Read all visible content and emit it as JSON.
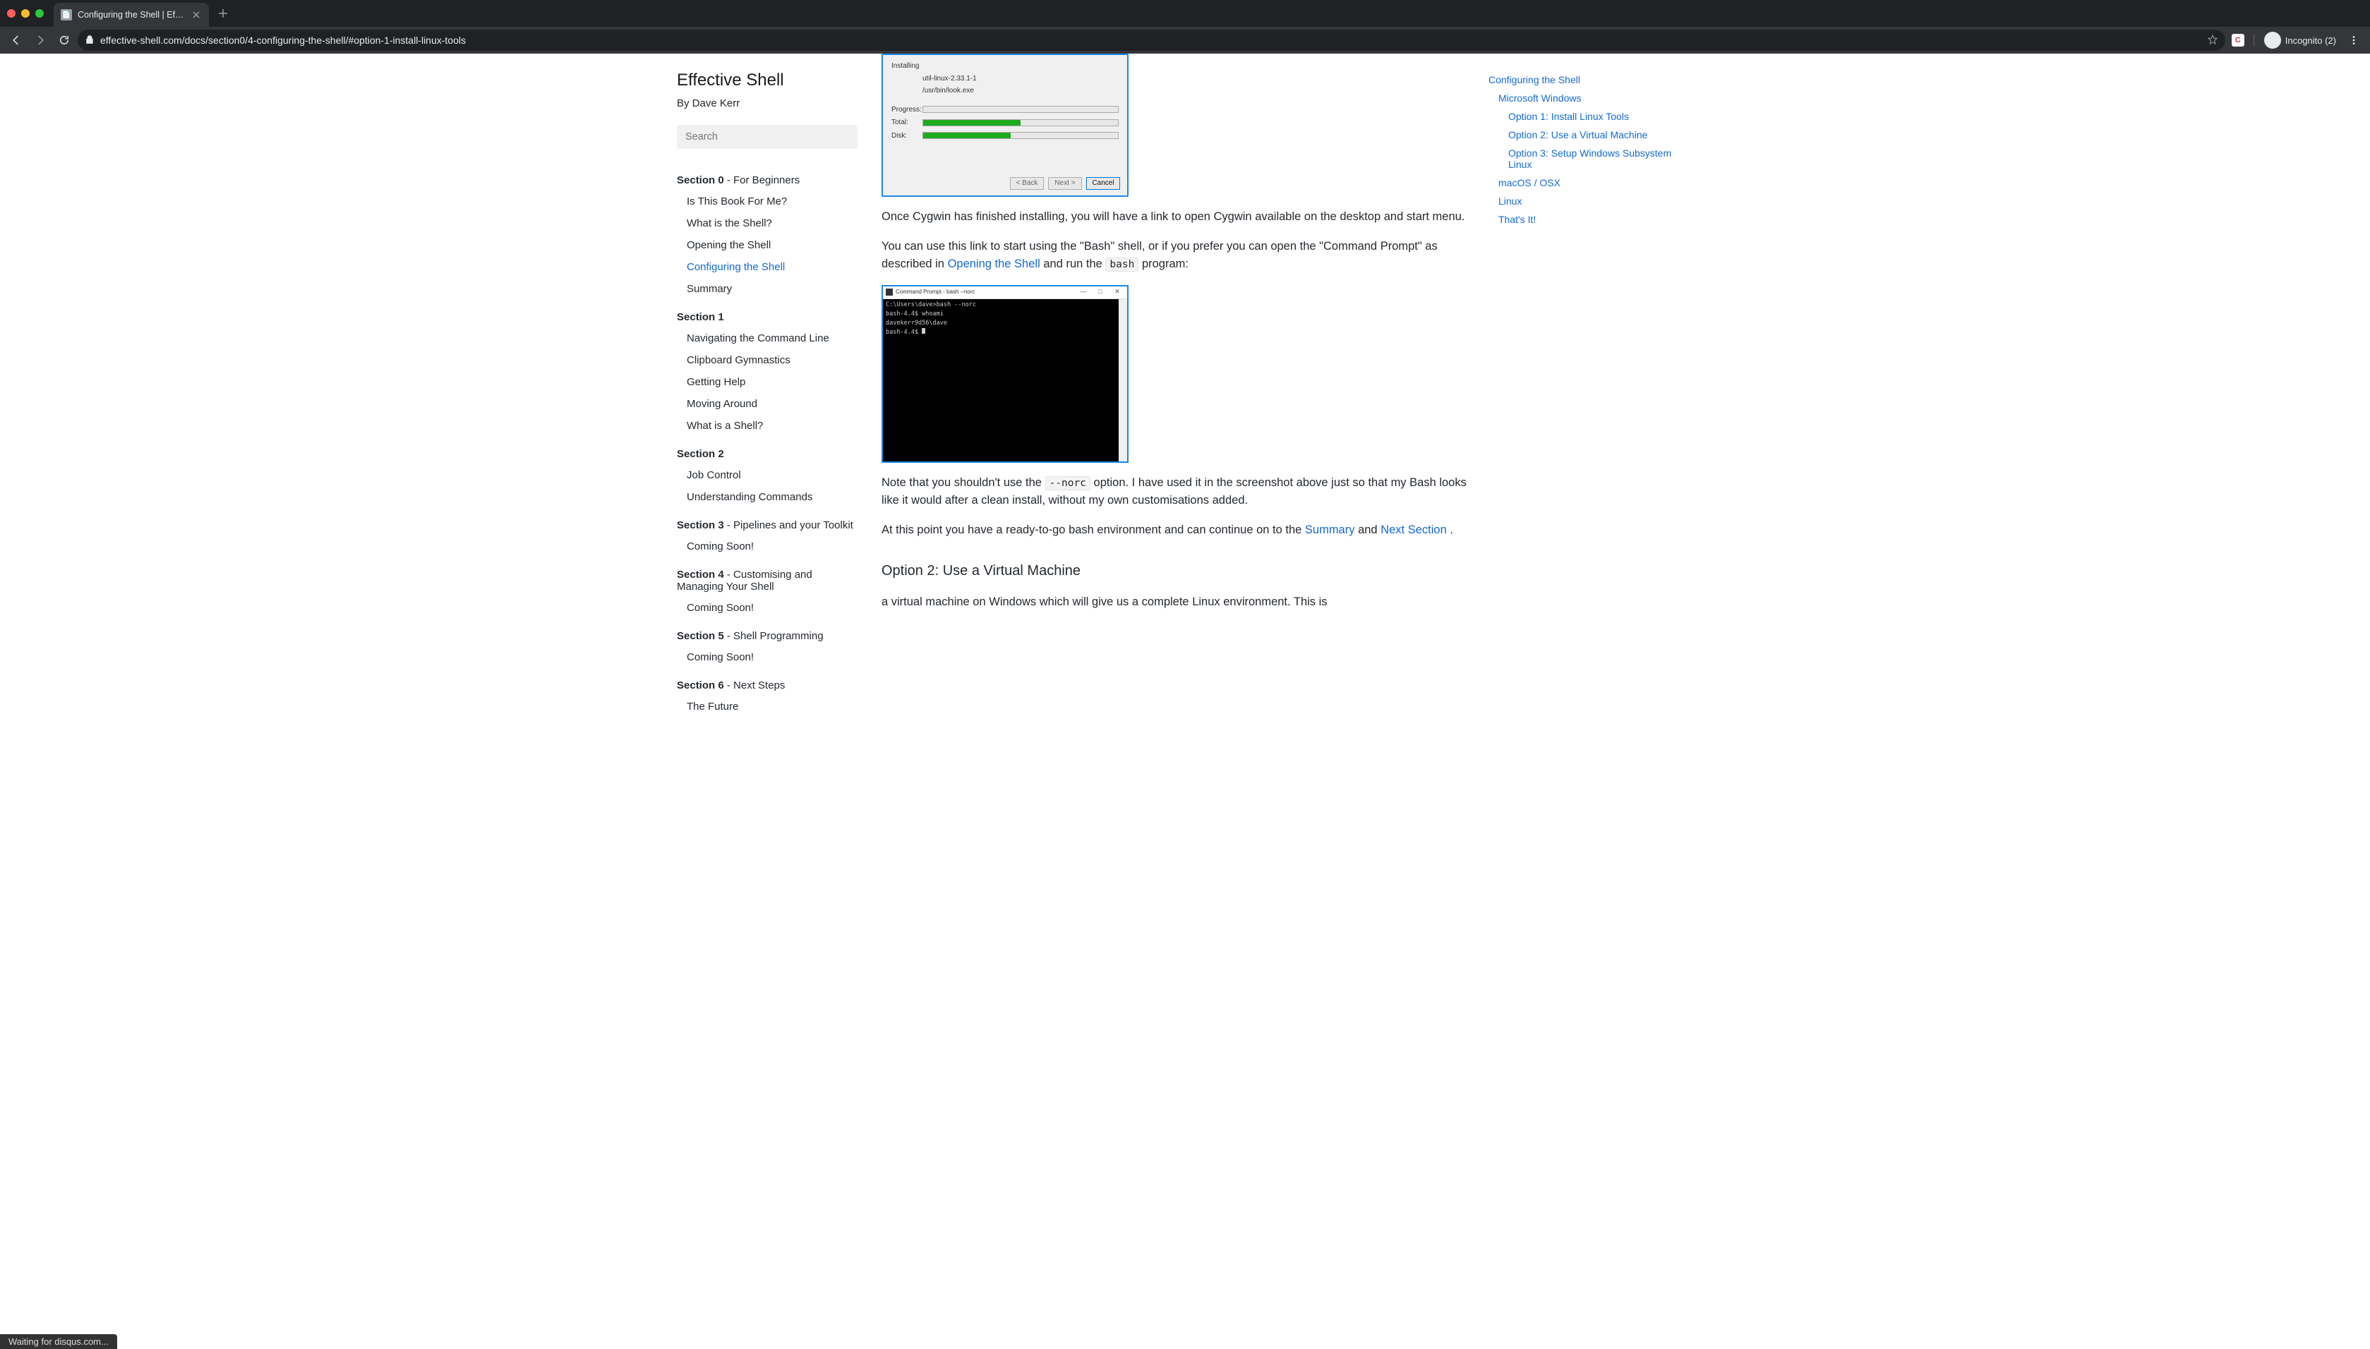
{
  "browser": {
    "tab_title": "Configuring the Shell | Effectiv",
    "url": "effective-shell.com/docs/section0/4-configuring-the-shell/#option-1-install-linux-tools",
    "incognito_label": "Incognito (2)",
    "status_text": "Waiting for disqus.com..."
  },
  "site": {
    "title": "Effective Shell",
    "byline": "By Dave Kerr",
    "search_placeholder": "Search"
  },
  "nav": {
    "s0_title_b": "Section 0",
    "s0_title_r": " - For Beginners",
    "s0_items": [
      "Is This Book For Me?",
      "What is the Shell?",
      "Opening the Shell",
      "Configuring the Shell",
      "Summary"
    ],
    "s1_title_b": "Section 1",
    "s1_title_r": "",
    "s1_items": [
      "Navigating the Command Line",
      "Clipboard Gymnastics",
      "Getting Help",
      "Moving Around",
      "What is a Shell?"
    ],
    "s2_title_b": "Section 2",
    "s2_title_r": "",
    "s2_items": [
      "Job Control",
      "Understanding Commands"
    ],
    "s3_title_b": "Section 3",
    "s3_title_r": " - Pipelines and your Toolkit",
    "s3_items": [
      "Coming Soon!"
    ],
    "s4_title_b": "Section 4",
    "s4_title_r": " - Customising and Managing Your Shell",
    "s4_items": [
      "Coming Soon!"
    ],
    "s5_title_b": "Section 5",
    "s5_title_r": " - Shell Programming",
    "s5_items": [
      "Coming Soon!"
    ],
    "s6_title_b": "Section 6",
    "s6_title_r": " - Next Steps",
    "s6_items": [
      "The Future"
    ]
  },
  "cygwin": {
    "installing": "Installing",
    "pkg": "util-linux-2.33.1-1",
    "path": "/usr/bin/look.exe",
    "lbl_progress": "Progress:",
    "lbl_total": "Total:",
    "lbl_disk": "Disk:",
    "btn_back": "< Back",
    "btn_next": "Next >",
    "btn_cancel": "Cancel"
  },
  "term": {
    "title": "Command Prompt - bash  --norc",
    "line1": "C:\\Users\\dave>bash --norc",
    "line2": "bash-4.4$ whoami",
    "line3": "davekerr9d56\\dave",
    "line4": "bash-4.4$ "
  },
  "content": {
    "p1": "Once Cygwin has finished installing, you will have a link to open Cygwin available on the desktop and start menu.",
    "p2a": "You can use this link to start using the \"Bash\" shell, or if you prefer you can open the \"Command Prompt\" as described in ",
    "p2_link": "Opening the Shell",
    "p2b": " and run the ",
    "p2_code": "bash",
    "p2c": " program:",
    "p3a": "Note that you shouldn't use the ",
    "p3_code": "--norc",
    "p3b": " option. I have used it in the screenshot above just so that my Bash looks like it would after a clean install, without my own customisations added.",
    "p4a": "At this point you have a ready-to-go bash environment and can continue on to the ",
    "p4_link1": "Summary",
    "p4b": " and ",
    "p4_link2": "Next Section",
    "p4c": ".",
    "h_option2": "Option 2: Use a Virtual Machine",
    "p5": "a virtual machine on Windows which will give us a complete Linux environment. This is"
  },
  "toc": {
    "t0": "Configuring the Shell",
    "t1": "Microsoft Windows",
    "t2": "Option 1: Install Linux Tools",
    "t3": "Option 2: Use a Virtual Machine",
    "t4": "Option 3: Setup Windows Subsystem Linux",
    "t5": "macOS / OSX",
    "t6": "Linux",
    "t7": "That's It!"
  }
}
